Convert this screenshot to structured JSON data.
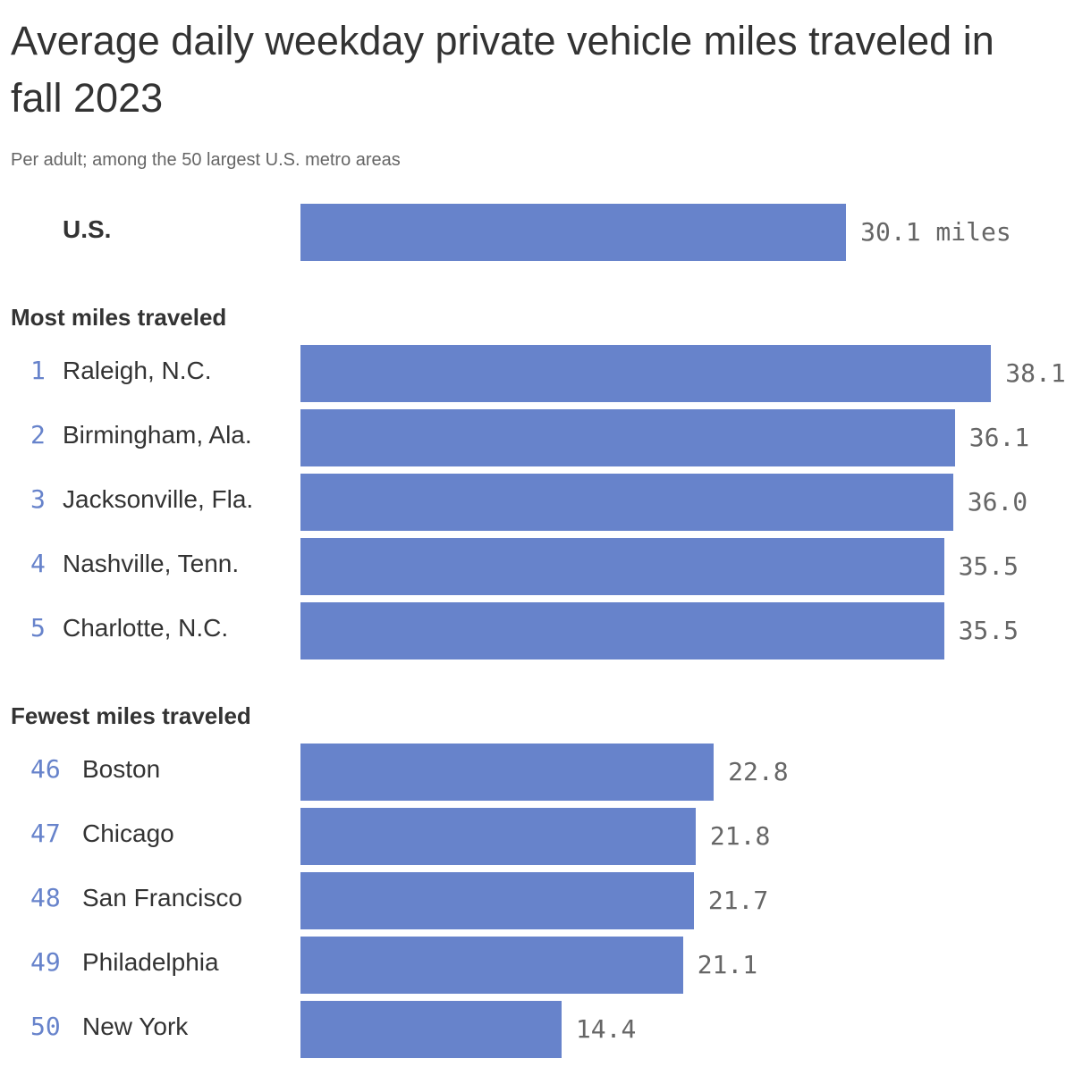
{
  "chart_data": {
    "type": "bar",
    "orientation": "horizontal",
    "title": "Average daily weekday private vehicle miles traveled in fall 2023",
    "subtitle": "Per adult; among the 50 largest U.S. metro areas",
    "unit": "miles",
    "bar_color": "#6783cb",
    "xlim": [
      0,
      40
    ],
    "us": {
      "label": "U.S.",
      "value": 30.1,
      "value_label": "30.1 miles"
    },
    "groups": [
      {
        "heading": "Most miles traveled",
        "rows": [
          {
            "rank": "1",
            "label": "Raleigh, N.C.",
            "value": 38.1,
            "value_label": "38.1"
          },
          {
            "rank": "2",
            "label": "Birmingham, Ala.",
            "value": 36.1,
            "value_label": "36.1"
          },
          {
            "rank": "3",
            "label": "Jacksonville, Fla.",
            "value": 36.0,
            "value_label": "36.0"
          },
          {
            "rank": "4",
            "label": "Nashville, Tenn.",
            "value": 35.5,
            "value_label": "35.5"
          },
          {
            "rank": "5",
            "label": "Charlotte, N.C.",
            "value": 35.5,
            "value_label": "35.5"
          }
        ]
      },
      {
        "heading": "Fewest miles traveled",
        "rows": [
          {
            "rank": "46",
            "label": "Boston",
            "value": 22.8,
            "value_label": "22.8"
          },
          {
            "rank": "47",
            "label": "Chicago",
            "value": 21.8,
            "value_label": "21.8"
          },
          {
            "rank": "48",
            "label": "San Francisco",
            "value": 21.7,
            "value_label": "21.7"
          },
          {
            "rank": "49",
            "label": "Philadelphia",
            "value": 21.1,
            "value_label": "21.1"
          },
          {
            "rank": "50",
            "label": "New York",
            "value": 14.4,
            "value_label": "14.4"
          }
        ]
      }
    ]
  }
}
